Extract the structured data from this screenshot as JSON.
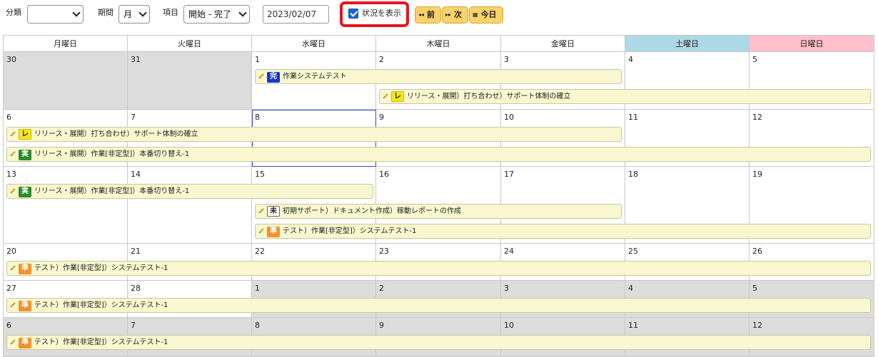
{
  "toolbar": {
    "category_label": "分類",
    "category_value": "",
    "period_label": "期間",
    "period_value": "月",
    "item_label": "項目",
    "item_value": "開始 - 完了",
    "date_value": "2023/02/07",
    "show_status_label": "状況を表示",
    "show_status_checked": true,
    "prev_label": "前",
    "next_label": "次",
    "today_label": "今日",
    "accent_color": "#f8d26a",
    "highlight_color": "#e8141b"
  },
  "calendar": {
    "weekdays": [
      "月曜日",
      "火曜日",
      "水曜日",
      "木曜日",
      "金曜日",
      "土曜日",
      "日曜日"
    ],
    "weekday_colors": {
      "saturday": "#add8e6",
      "sunday": "#ffc0cb"
    },
    "weeks": [
      {
        "days": [
          "30",
          "31",
          "1",
          "2",
          "3",
          "4",
          "5"
        ],
        "other_month": [
          true,
          true,
          false,
          false,
          false,
          false,
          false
        ]
      },
      {
        "days": [
          "6",
          "7",
          "8",
          "9",
          "10",
          "11",
          "12"
        ],
        "other_month": [
          false,
          false,
          false,
          false,
          false,
          false,
          false
        ]
      },
      {
        "days": [
          "13",
          "14",
          "15",
          "16",
          "17",
          "18",
          "19"
        ],
        "other_month": [
          false,
          false,
          false,
          false,
          false,
          false,
          false
        ]
      },
      {
        "days": [
          "20",
          "21",
          "22",
          "23",
          "24",
          "25",
          "26"
        ],
        "other_month": [
          false,
          false,
          false,
          false,
          false,
          false,
          false
        ]
      },
      {
        "days": [
          "27",
          "28",
          "1",
          "2",
          "3",
          "4",
          "5"
        ],
        "other_month": [
          false,
          false,
          true,
          true,
          true,
          true,
          true
        ]
      },
      {
        "days": [
          "6",
          "7",
          "8",
          "9",
          "10",
          "11",
          "12"
        ],
        "other_month": [
          true,
          true,
          true,
          true,
          true,
          true,
          true
        ]
      }
    ],
    "today": "8",
    "events": [
      {
        "badge": "完",
        "status": "done",
        "title": "作業システムテスト"
      },
      {
        "badge": "レ",
        "status": "review",
        "title": "リリース・展開）打ち合わせ）サポート体制の確立"
      },
      {
        "badge": "レ",
        "status": "review",
        "title": "リリース・展開）打ち合わせ）サポート体制の確立"
      },
      {
        "badge": "実",
        "status": "exec",
        "title": "リリース・展開）作業[非定型]）本番切り替え-1"
      },
      {
        "badge": "実",
        "status": "exec",
        "title": "リリース・展開）作業[非定型]）本番切り替え-1"
      },
      {
        "badge": "未",
        "status": "pending",
        "title": "初期サポート）ドキュメント作成）稼動レポートの作成"
      },
      {
        "badge": "準",
        "status": "prep",
        "title": "テスト）作業[非定型]）システムテスト-1"
      },
      {
        "badge": "準",
        "status": "prep",
        "title": "テスト）作業[非定型]）システムテスト-1"
      },
      {
        "badge": "準",
        "status": "prep",
        "title": "テスト）作業[非定型]）システムテスト-1"
      },
      {
        "badge": "準",
        "status": "prep",
        "title": "テスト）作業[非定型]）システムテスト-1"
      }
    ]
  }
}
